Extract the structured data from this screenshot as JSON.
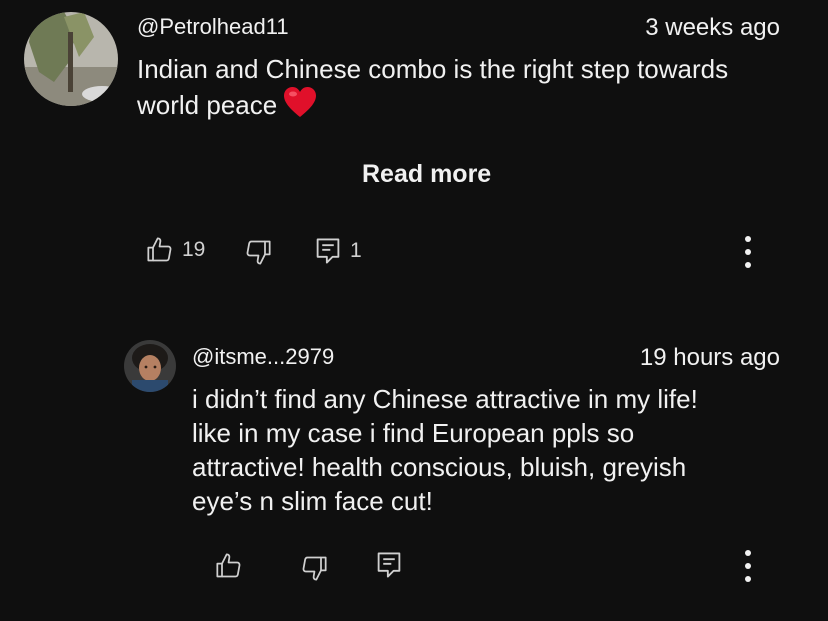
{
  "comment": {
    "handle": "@Petrolhead11",
    "time": "3 weeks ago",
    "text_line1": "Indian and Chinese combo is the right step towards",
    "text_line2": "world peace",
    "emoji": "heart-emoji",
    "read_more": "Read more",
    "likes": "19",
    "replies": "1"
  },
  "reply": {
    "handle": "@itsme...2979",
    "time": "19 hours ago",
    "lines": [
      "i didn’t find any Chinese attractive in my life!",
      "like in my case i find European ppls so",
      "attractive! health conscious, bluish, greyish",
      "eye’s n slim face cut!"
    ]
  },
  "colors": {
    "background": "#0f0f0f",
    "text": "#f1f1f1",
    "icon": "#d0d0d0",
    "heart": "#e0102a"
  }
}
